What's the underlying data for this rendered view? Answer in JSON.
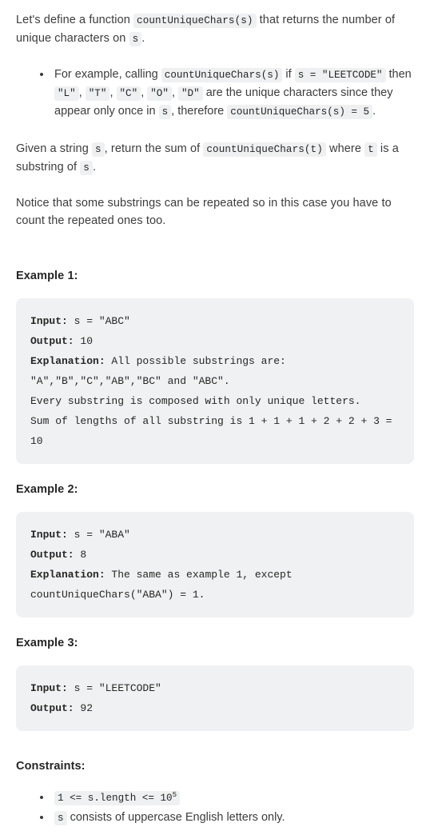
{
  "intro": {
    "line1_a": "Let's define a function ",
    "code_fn": "countUniqueChars(s)",
    "line1_b": " that returns the number of unique characters on ",
    "code_s": "s",
    "line1_c": "."
  },
  "intro_bullet": {
    "t1": "For example, calling ",
    "c1": "countUniqueChars(s)",
    "t2": " if ",
    "c2": "s = \"LEETCODE\"",
    "t3": " then ",
    "c3": "\"L\"",
    "t4": ", ",
    "c4": "\"T\"",
    "t5": ", ",
    "c5": "\"C\"",
    "t6": ", ",
    "c6": "\"O\"",
    "t7": ", ",
    "c7": "\"D\"",
    "t8": " are the unique characters since they appear only once in ",
    "c8": "s",
    "t9": ", therefore ",
    "c9": "countUniqueChars(s) = 5",
    "t10": "."
  },
  "given": {
    "t1": "Given a string ",
    "c1": "s",
    "t2": ", return the sum of ",
    "c2": "countUniqueChars(t)",
    "t3": " where ",
    "c3": "t",
    "t4": " is a substring of ",
    "c4": "s",
    "t5": "."
  },
  "notice": {
    "text": "Notice that some substrings can be repeated so in this case you have to count the repeated ones too."
  },
  "examples": [
    {
      "heading": "Example 1:",
      "lines": [
        {
          "label": "Input:",
          "value": " s = \"ABC\""
        },
        {
          "label": "Output:",
          "value": " 10"
        },
        {
          "label": "Explanation:",
          "value": " All possible substrings are:\n\"A\",\"B\",\"C\",\"AB\",\"BC\" and \"ABC\".\nEvery substring is composed with only unique letters.\nSum of lengths of all substring is 1 + 1 + 1 + 2 + 2 + 3 = 10"
        }
      ]
    },
    {
      "heading": "Example 2:",
      "lines": [
        {
          "label": "Input:",
          "value": " s = \"ABA\""
        },
        {
          "label": "Output:",
          "value": " 8"
        },
        {
          "label": "Explanation:",
          "value": " The same as example 1, except countUniqueChars(\"ABA\") = 1."
        }
      ]
    },
    {
      "heading": "Example 3:",
      "lines": [
        {
          "label": "Input:",
          "value": " s = \"LEETCODE\""
        },
        {
          "label": "Output:",
          "value": " 92"
        }
      ]
    }
  ],
  "constraints": {
    "heading": "Constraints:",
    "items": [
      {
        "code_pre": "1 <= s.length <= 10",
        "code_sup": "5",
        "text": ""
      },
      {
        "code_pre": "s",
        "code_sup": "",
        "text": " consists of uppercase English letters only."
      }
    ]
  }
}
